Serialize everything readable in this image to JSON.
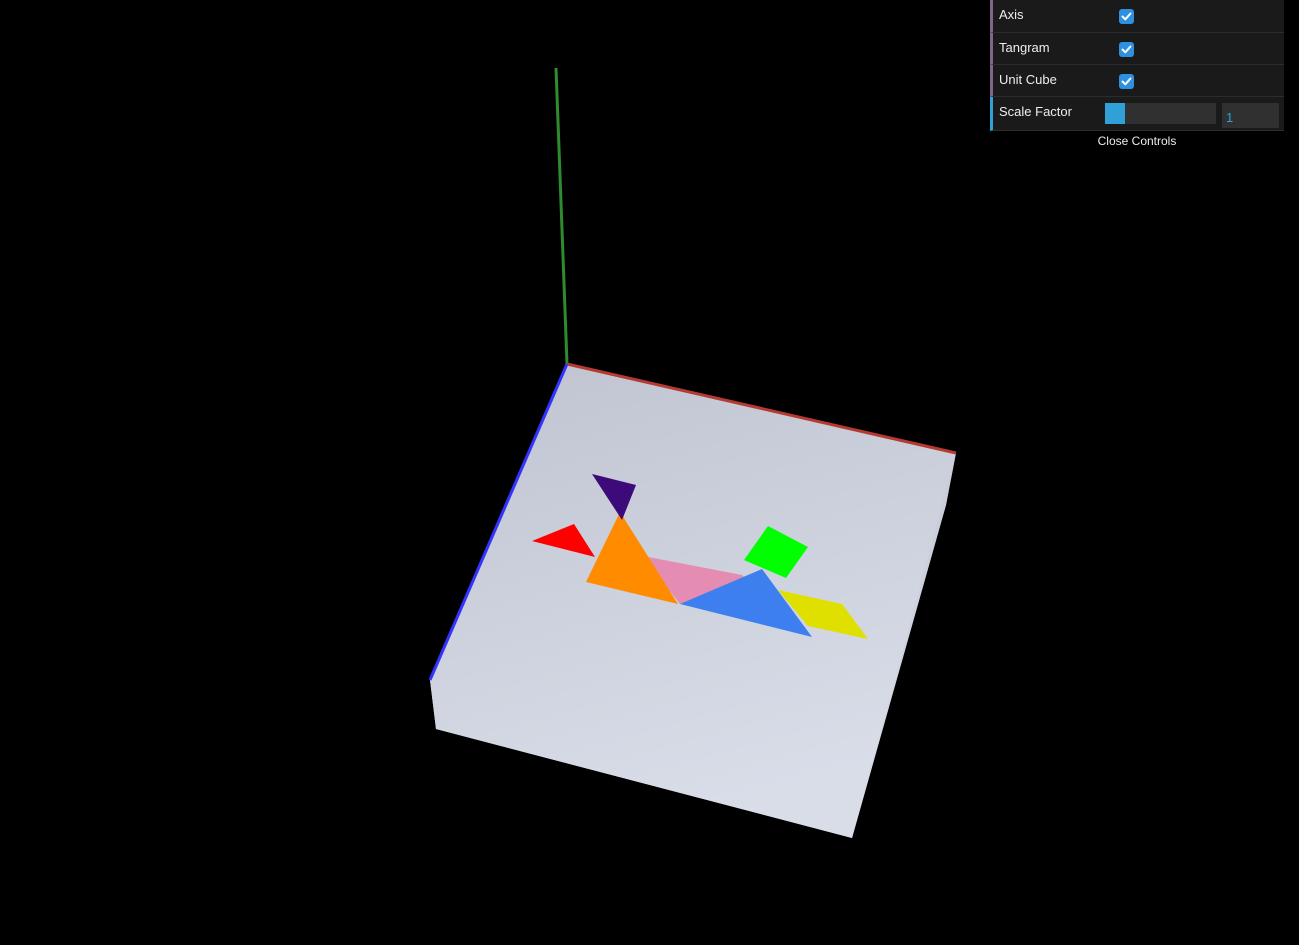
{
  "controls": {
    "axis": {
      "label": "Axis",
      "checked": true
    },
    "tangram": {
      "label": "Tangram",
      "checked": true
    },
    "unit_cube": {
      "label": "Unit Cube",
      "checked": true
    },
    "scale_factor": {
      "label": "Scale Factor",
      "value": "1",
      "fill_fraction": 0.18
    },
    "close_label": "Close Controls"
  },
  "scene": {
    "background": "#000000",
    "axis_colors": {
      "x": "#c0392b",
      "y": "#2e8b2e",
      "z": "#3333ff"
    },
    "cube_color": "#cdd3df",
    "tangram_colors": {
      "small_triangle_purple": "#3d0a7a",
      "small_triangle_red": "#ff0000",
      "large_triangle_orange": "#ff8c00",
      "parallelogram_pink": "#e58cb3",
      "large_triangle_blue": "#3e7ff0",
      "square_green": "#00ff00",
      "parallelogram_yellow": "#e0e000"
    }
  }
}
